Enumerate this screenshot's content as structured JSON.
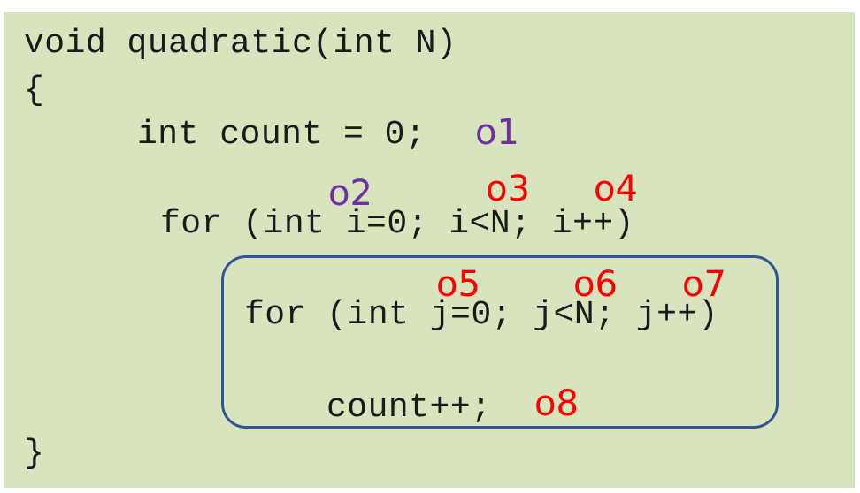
{
  "code": {
    "signature": "void quadratic(int N)",
    "open_brace": "{",
    "count_init": "int count = 0;",
    "outer_for": "for (int i=0; i<N; i++)",
    "inner_for": "for (int j=0; j<N; j++)",
    "increment": "count++;",
    "close_brace": "}"
  },
  "operation_labels": {
    "o1": "o1",
    "o2": "o2",
    "o3": "o3",
    "o4": "o4",
    "o5": "o5",
    "o6": "o6",
    "o7": "o7",
    "o8": "o8"
  },
  "colors": {
    "panel_background": "#d7e4bd",
    "code_text": "#1a1a1a",
    "label_purple": "#7030a0",
    "label_red": "#ff0000",
    "box_border": "#2f5597"
  }
}
